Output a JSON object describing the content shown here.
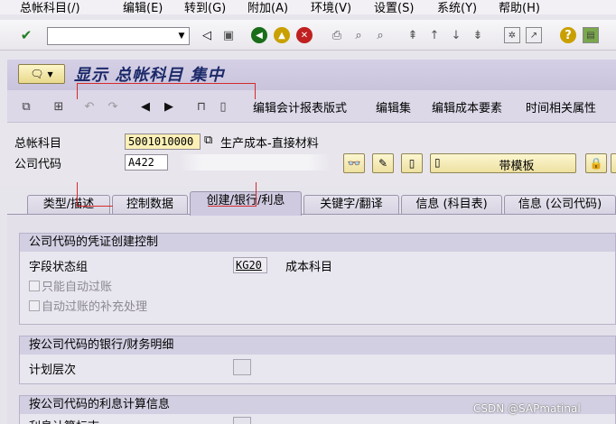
{
  "menu": {
    "items": [
      "总帐科目(/)",
      "编辑(E)",
      "转到(G)",
      "附加(A)",
      "环境(V)",
      "设置(S)",
      "系统(Y)",
      "帮助(H)"
    ]
  },
  "toolbar": {
    "command_value": ""
  },
  "title": {
    "text": "显示 总帐科目 集中"
  },
  "app_toolbar": {
    "buttons": [
      "编辑会计报表版式",
      "编辑集",
      "编辑成本要素",
      "时间相关属性"
    ]
  },
  "header": {
    "gl_account_label": "总帐科目",
    "gl_account_value": "5001010000",
    "gl_account_desc": "生产成本-直接材料",
    "company_code_label": "公司代码",
    "company_code_value": "A422",
    "template_button": "带模板"
  },
  "tabs": [
    {
      "label": "类型/描述",
      "active": false
    },
    {
      "label": "控制数据",
      "active": false
    },
    {
      "label": "创建/银行/利息",
      "active": true
    },
    {
      "label": "关键字/翻译",
      "active": false
    },
    {
      "label": "信息 (科目表)",
      "active": false
    },
    {
      "label": "信息 (公司代码)",
      "active": false
    }
  ],
  "groups": {
    "doc_creation": {
      "title": "公司代码的凭证创建控制",
      "field_status_label": "字段状态组",
      "field_status_value": "KG20",
      "field_status_desc": "成本科目",
      "cb_auto_only": "只能自动过账",
      "cb_supplement": "自动过账的补充处理"
    },
    "bank": {
      "title": "按公司代码的银行/财务明细",
      "planning_level_label": "计划层次"
    },
    "interest": {
      "title": "按公司代码的利息计算信息",
      "interest_label": "利息计算标志"
    }
  },
  "watermark": "CSDN @SAPmatinal",
  "colors": {
    "title_text": "#1c2a6a",
    "required_field": "#fbf0b6",
    "annotation_red": "#d42b2b"
  }
}
